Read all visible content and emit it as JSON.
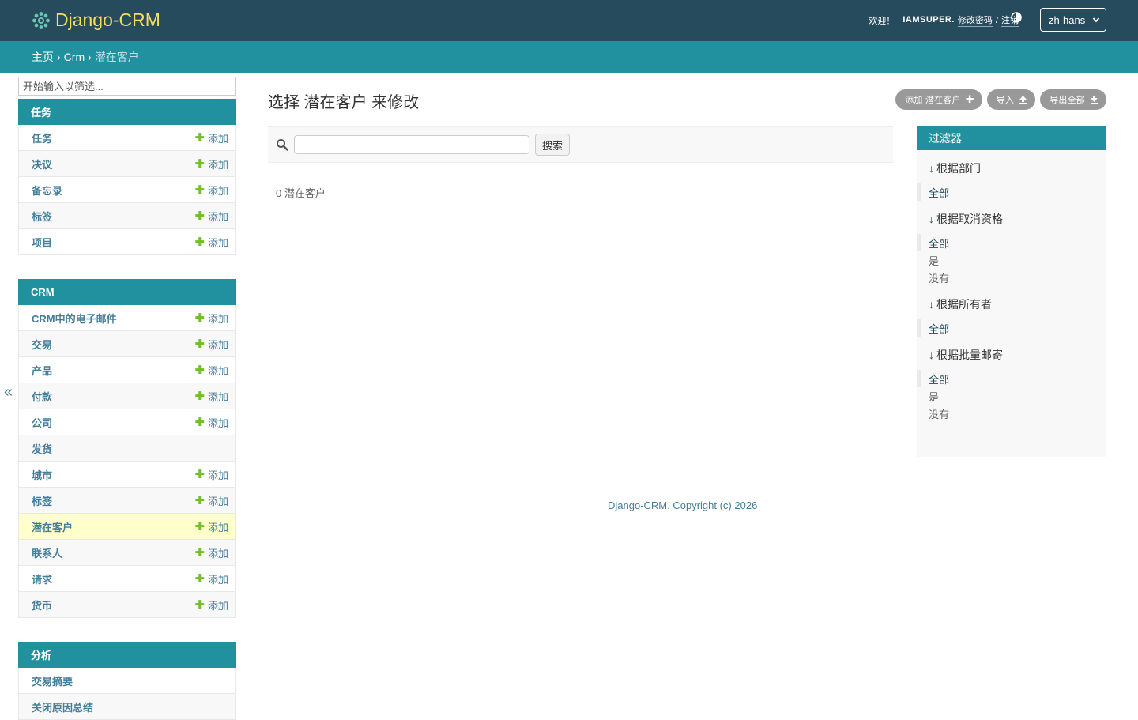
{
  "header": {
    "brand": "Django-CRM",
    "welcome": "欢迎！",
    "username": "IAMSUPER.",
    "change_password": "修改密码",
    "separator": "/",
    "logout": "注销",
    "language": "zh-hans"
  },
  "breadcrumbs": {
    "home": "主页",
    "app": "Crm",
    "current": "潜在客户",
    "sep": "›"
  },
  "sidebar": {
    "filter_placeholder": "开始输入以筛选...",
    "collapse_label": "«",
    "modules": [
      {
        "caption": "任务",
        "items": [
          {
            "label": "任务",
            "add": "添加"
          },
          {
            "label": "决议",
            "add": "添加"
          },
          {
            "label": "备忘录",
            "add": "添加"
          },
          {
            "label": "标签",
            "add": "添加"
          },
          {
            "label": "项目",
            "add": "添加"
          }
        ]
      },
      {
        "caption": "CRM",
        "items": [
          {
            "label": "CRM中的电子邮件",
            "add": "添加"
          },
          {
            "label": "交易",
            "add": "添加"
          },
          {
            "label": "产品",
            "add": "添加"
          },
          {
            "label": "付款",
            "add": "添加"
          },
          {
            "label": "公司",
            "add": "添加"
          },
          {
            "label": "发货",
            "add": ""
          },
          {
            "label": "城市",
            "add": "添加"
          },
          {
            "label": "标签",
            "add": "添加"
          },
          {
            "label": "潜在客户",
            "add": "添加"
          },
          {
            "label": "联系人",
            "add": "添加"
          },
          {
            "label": "请求",
            "add": "添加"
          },
          {
            "label": "货币",
            "add": "添加"
          }
        ]
      },
      {
        "caption": "分析",
        "items": [
          {
            "label": "交易摘要",
            "add": ""
          },
          {
            "label": "关闭原因总结",
            "add": ""
          }
        ]
      }
    ]
  },
  "content": {
    "title": "选择 潜在客户 来修改",
    "tools": {
      "add": "添加 潜在客户",
      "import": "导入",
      "export": "导出全部"
    },
    "search_button": "搜索",
    "result_count": "0 潜在客户"
  },
  "filter": {
    "title": "过滤器",
    "arrow": "↓",
    "groups": [
      {
        "heading": "根据部门",
        "options": [
          "全部"
        ]
      },
      {
        "heading": "根据取消资格",
        "options": [
          "全部",
          "是",
          "没有"
        ]
      },
      {
        "heading": "根据所有者",
        "options": [
          "全部"
        ]
      },
      {
        "heading": "根据批量邮寄",
        "options": [
          "全部",
          "是",
          "没有"
        ]
      }
    ]
  },
  "footer": "Django-CRM. Copyright (c) 2026",
  "colors": {
    "header_bg": "#264b5d",
    "accent": "#2191a0",
    "brand": "#f5dd5d",
    "link": "#447e9b",
    "add_icon": "#70bf2b",
    "current_row": "#ffffcc"
  }
}
